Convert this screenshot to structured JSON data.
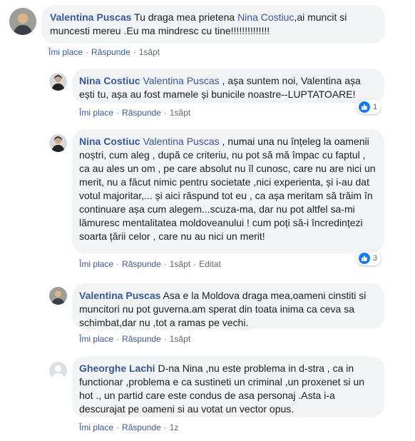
{
  "comments": [
    {
      "author": "Valentina Puscas",
      "text_pre": " Tu draga mea prietena ",
      "mention": "Nina Costiuc",
      "text_post": ",ai muncit si muncesti mereu .Eu ma mindresc cu tine!!!!!!!!!!!!!!",
      "like": "Îmi place",
      "reply": "Răspunde",
      "time": "1săpt"
    },
    {
      "author": "Nina Costiuc",
      "mention": "Valentina Puscas",
      "text_post": " , așa suntem noi, Valentina așa ești tu, așa au fost mamele și bunicile noastre--LUPTATOARE!",
      "like": "Îmi place",
      "reply": "Răspunde",
      "time": "1săpt",
      "reactions": "1"
    },
    {
      "author": "Nina Costiuc",
      "mention": "Valentina Puscas",
      "text_post": " , numai una nu înțeleg la oamenii noștri, cum aleg , după ce criteriu, nu pot să mă împac cu faptul , ca au ales un om , pe care absolut nu îl cunosc, care nu are nici un merit, nu a făcut nimic pentru societate ,nici experienta, și i-au dat votul majoritar,... și aici răspund tot eu , ca așa meritam să trăim în continuare așa cum alegem...scuza-ma, dar nu pot altfel sa-mi lămuresc mentalitatea moldoveanului ! cum poți să-i încredințezi soarta țării celor , care nu au nici un merit!",
      "like": "Îmi place",
      "reply": "Răspunde",
      "time": "1săpt",
      "edited": "Editat",
      "reactions": "3"
    },
    {
      "author": "Valentina Puscas",
      "text_post": " Asa e la Moldova draga mea,oameni cinstiti si muncitori nu pot guverna.am sperat din toata inima ca ceva sa schimbat,dar nu ,tot a ramas pe vechi.",
      "like": "Îmi place",
      "reply": "Răspunde",
      "time": "1săpt"
    },
    {
      "author": "Gheorghe Lachi",
      "text_post": " D-na Nina ,nu este problema in d-stra , ca in functionar ,problema e ca sustineti un criminal ,un proxenet si un hot ., un partid care este condus de asa personaj .Asta i-a descurajat pe oameni si au votat un vector opus.",
      "like": "Îmi place",
      "reply": "Răspunde",
      "time": "1z"
    }
  ],
  "colors": {
    "link": "#385898",
    "bubble": "#f2f3f5",
    "meta": "#606770",
    "like_badge": "#1877f2"
  },
  "icons": [
    "avatar-valentina",
    "avatar-nina",
    "avatar-gheorghe-placeholder",
    "like-reaction-icon"
  ]
}
